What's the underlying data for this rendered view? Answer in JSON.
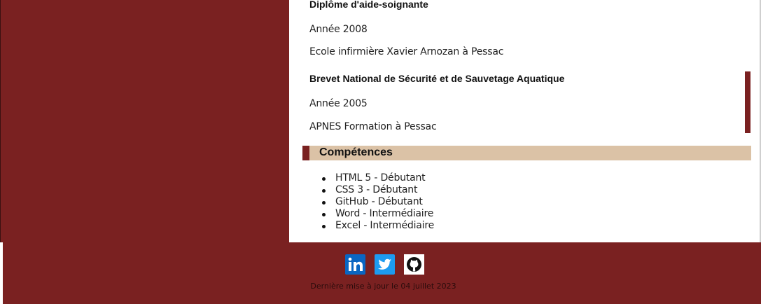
{
  "education": [
    {
      "title": "Diplôme d'aide-soignante",
      "year": "Année 2008",
      "school": "Ecole infirmière Xavier Arnozan à Pessac"
    },
    {
      "title": "Brevet National de Sécurité et de Sauvetage Aquatique",
      "year": "Année 2005",
      "school": "APNES Formation à Pessac"
    }
  ],
  "skills_section": {
    "title": "Compétences",
    "items": [
      "HTML 5 - Débutant",
      "CSS 3 - Débutant",
      "GitHub - Débutant",
      "Word - Intermédiaire",
      "Excel - Intermédiaire"
    ]
  },
  "footer": {
    "social": [
      {
        "icon": "linkedin-icon",
        "color": "#0a66c2"
      },
      {
        "icon": "twitter-icon",
        "color": "#1d9bf0"
      },
      {
        "icon": "github-icon",
        "color": "#111111"
      }
    ],
    "updated": "Dernière mise à jour le 04 juillet 2023"
  },
  "colors": {
    "accent": "#7a2121",
    "section_bg": "#dbc2a6"
  }
}
